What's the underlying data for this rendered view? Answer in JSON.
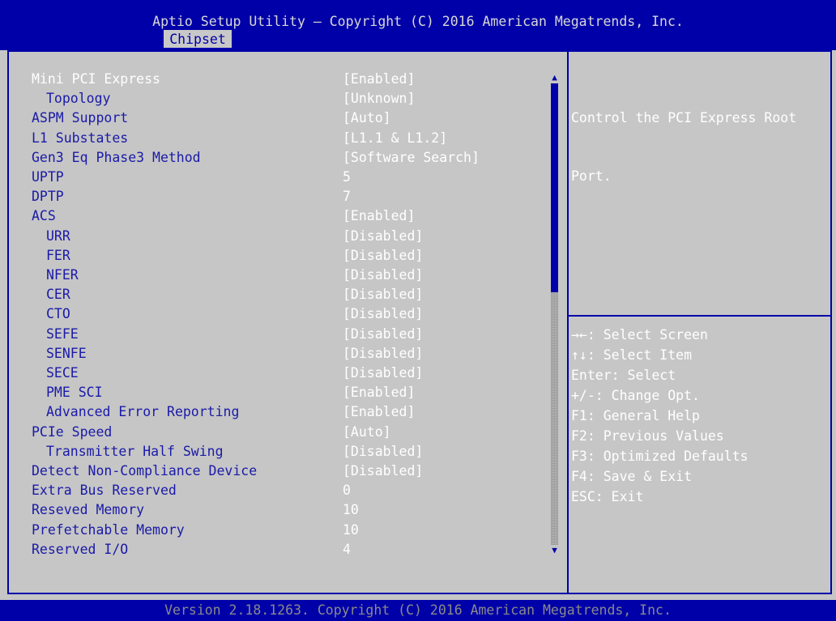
{
  "header": {
    "title": "Aptio Setup Utility – Copyright (C) 2016 American Megatrends, Inc.",
    "tab": "Chipset"
  },
  "settings": [
    {
      "label": "Mini PCI Express",
      "value": "[Enabled]",
      "indent": false,
      "selected": true
    },
    {
      "label": "Topology",
      "value": "[Unknown]",
      "indent": true,
      "selected": false
    },
    {
      "label": "ASPM Support",
      "value": "[Auto]",
      "indent": false,
      "selected": false
    },
    {
      "label": "L1 Substates",
      "value": "[L1.1 & L1.2]",
      "indent": false,
      "selected": false
    },
    {
      "label": "Gen3 Eq Phase3 Method",
      "value": "[Software Search]",
      "indent": false,
      "selected": false
    },
    {
      "label": "UPTP",
      "value": "5",
      "indent": false,
      "selected": false
    },
    {
      "label": "DPTP",
      "value": "7",
      "indent": false,
      "selected": false
    },
    {
      "label": "ACS",
      "value": "[Enabled]",
      "indent": false,
      "selected": false
    },
    {
      "label": "URR",
      "value": "[Disabled]",
      "indent": true,
      "selected": false
    },
    {
      "label": "FER",
      "value": "[Disabled]",
      "indent": true,
      "selected": false
    },
    {
      "label": "NFER",
      "value": "[Disabled]",
      "indent": true,
      "selected": false
    },
    {
      "label": "CER",
      "value": "[Disabled]",
      "indent": true,
      "selected": false
    },
    {
      "label": "CTO",
      "value": "[Disabled]",
      "indent": true,
      "selected": false
    },
    {
      "label": "SEFE",
      "value": "[Disabled]",
      "indent": true,
      "selected": false
    },
    {
      "label": "SENFE",
      "value": "[Disabled]",
      "indent": true,
      "selected": false
    },
    {
      "label": "SECE",
      "value": "[Disabled]",
      "indent": true,
      "selected": false
    },
    {
      "label": "PME SCI",
      "value": "[Enabled]",
      "indent": true,
      "selected": false
    },
    {
      "label": "Advanced Error Reporting",
      "value": "[Enabled]",
      "indent": true,
      "selected": false
    },
    {
      "label": "PCIe Speed",
      "value": "[Auto]",
      "indent": false,
      "selected": false
    },
    {
      "label": "Transmitter Half Swing",
      "value": "[Disabled]",
      "indent": true,
      "selected": false
    },
    {
      "label": "Detect Non-Compliance Device",
      "value": "[Disabled]",
      "indent": false,
      "selected": false
    },
    {
      "label": "Extra Bus Reserved",
      "value": "0",
      "indent": false,
      "selected": false
    },
    {
      "label": "Reseved Memory",
      "value": "10",
      "indent": false,
      "selected": false
    },
    {
      "label": "Prefetchable Memory",
      "value": "10",
      "indent": false,
      "selected": false
    },
    {
      "label": "Reserved I/O",
      "value": "4",
      "indent": false,
      "selected": false
    }
  ],
  "scrollbar": {
    "up_icon": "triangle-up-icon",
    "down_icon": "triangle-down-icon"
  },
  "help": {
    "lines": [
      "Control the PCI Express Root",
      "Port."
    ]
  },
  "keys": [
    "→←: Select Screen",
    "↑↓: Select Item",
    "Enter: Select",
    "+/-: Change Opt.",
    "F1: General Help",
    "F2: Previous Values",
    "F3: Optimized Defaults",
    "F4: Save & Exit",
    "ESC: Exit"
  ],
  "footer": {
    "version": "Version 2.18.1263. Copyright (C) 2016 American Megatrends, Inc."
  },
  "colors": {
    "header_bg": "#0000a8",
    "panel_bg": "#c6c6c6",
    "label_blue": "#1a1aa8",
    "value_white": "#ffffff"
  }
}
